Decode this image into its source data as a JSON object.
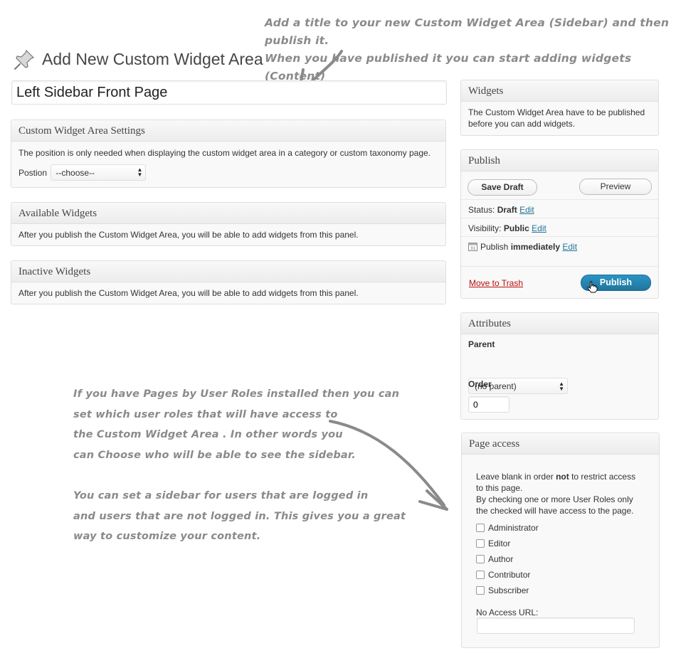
{
  "annotations": {
    "top": [
      "Add a title to your new Custom Widget Area (Sidebar) and then publish it.",
      "When you have published it you can start adding widgets (Content)"
    ],
    "bottom_para1": [
      "If you have Pages by User Roles installed then you can",
      "set which user roles that will have access to",
      "the Custom Widget Area . In other words you",
      "can Choose who will be able to see the sidebar."
    ],
    "bottom_para2": [
      "You can set a sidebar for users that are logged in",
      "and users that are not logged in. This gives you a great",
      "way to customize your content."
    ]
  },
  "page": {
    "title": "Add New Custom Widget Area",
    "title_input_value": "Left Sidebar Front Page"
  },
  "settings_box": {
    "heading": "Custom Widget Area Settings",
    "description": "The position is only needed when displaying the custom widget area in a category or custom taxonomy page.",
    "position_label": "Postion",
    "position_selected": "--choose--"
  },
  "available_widgets": {
    "heading": "Available Widgets",
    "text": "After you publish the Custom Widget Area, you will be able to add widgets from this panel."
  },
  "inactive_widgets": {
    "heading": "Inactive Widgets",
    "text": "After you publish the Custom Widget Area, you will be able to add widgets from this panel."
  },
  "widgets_box": {
    "heading": "Widgets",
    "text_line1": "The Custom Widget Area have to be published",
    "text_line2": "before you can add widgets."
  },
  "publish_box": {
    "heading": "Publish",
    "save_draft": "Save Draft",
    "preview": "Preview",
    "status_label": "Status:",
    "status_value": "Draft",
    "visibility_label": "Visibility:",
    "visibility_value": "Public",
    "publish_label": "Publish",
    "publish_value": "immediately",
    "edit": "Edit",
    "move_to_trash": "Move to Trash",
    "publish_button": "Publish"
  },
  "attributes_box": {
    "heading": "Attributes",
    "parent_label": "Parent",
    "parent_selected": "(no parent)",
    "order_label": "Order",
    "order_value": "0"
  },
  "page_access_box": {
    "heading": "Page access",
    "intro_pre": "Leave blank in order ",
    "intro_bold": "not",
    "intro_post": " to restrict access",
    "intro_line2": "to this page.",
    "intro_line3": "By checking one or more User Roles only",
    "intro_line4": "the checked will have access to the page.",
    "roles": [
      "Administrator",
      "Editor",
      "Author",
      "Contributor",
      "Subscriber"
    ],
    "no_access_label": "No Access URL:",
    "no_access_value": ""
  },
  "colors": {
    "link": "#21759b",
    "trash": "#bc0b0b",
    "publish_button": "#21759b",
    "annotation": "#8a8a8a"
  },
  "icons": [
    "pushpin-icon",
    "calendar-icon",
    "hand-cursor-icon",
    "arrow-icon"
  ]
}
